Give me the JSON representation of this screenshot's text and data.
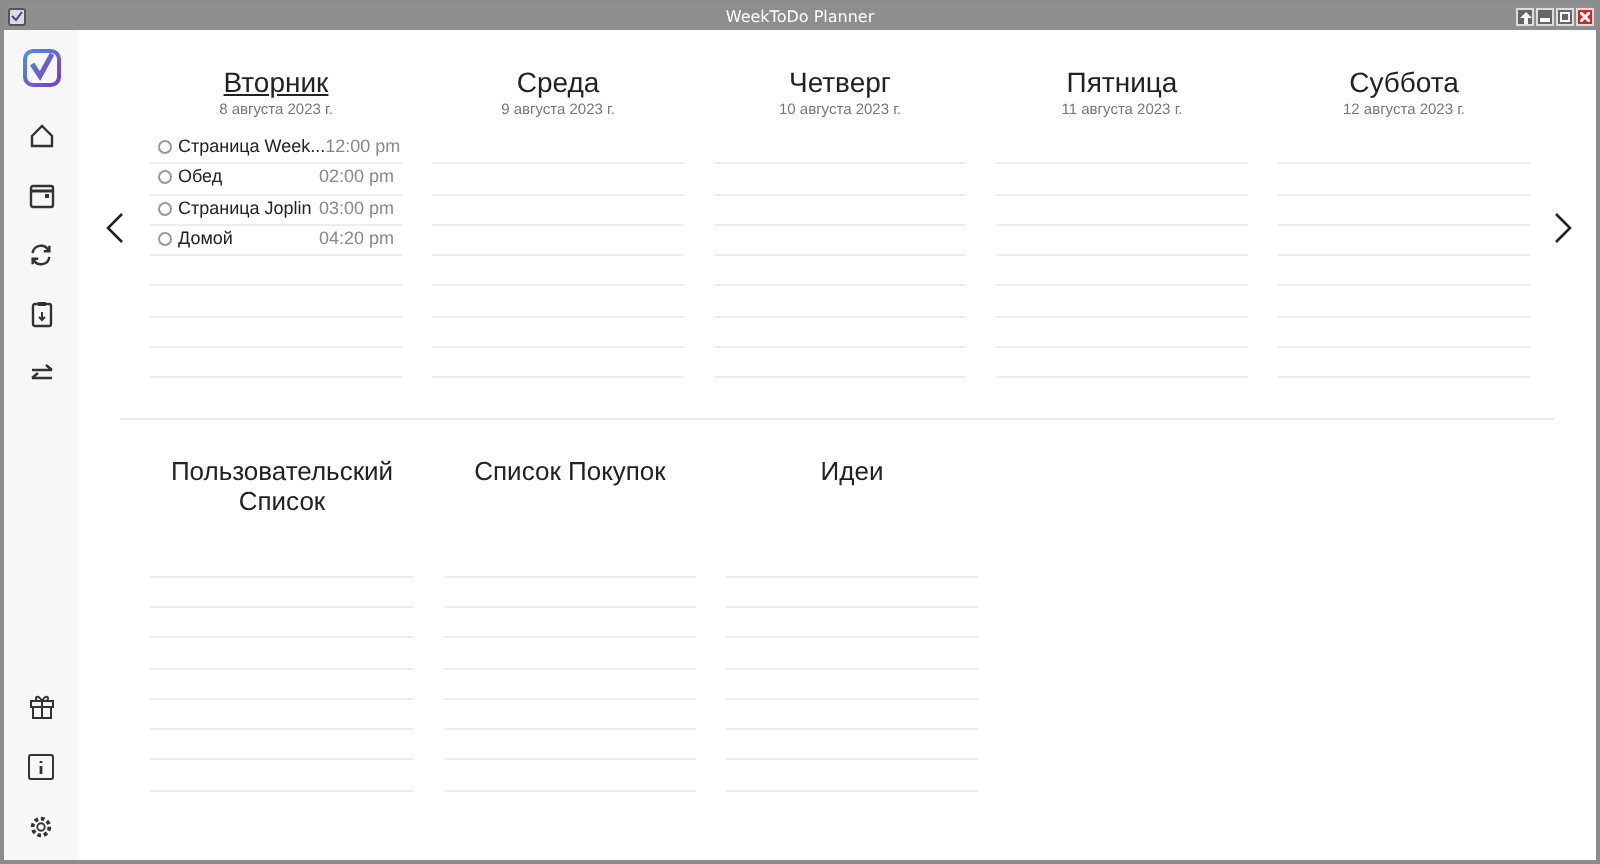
{
  "window": {
    "title": "WeekToDo Planner"
  },
  "days": [
    {
      "name": "Вторник",
      "date": "8 августа 2023 г.",
      "today": true,
      "tasks": [
        {
          "text": "Страница Week...",
          "time": "12:00 pm",
          "done": false
        },
        {
          "text": "Обед",
          "time": "02:00 pm",
          "done": false
        },
        {
          "text": "Страница Joplin",
          "time": "03:00 pm",
          "done": false
        },
        {
          "text": "Домой",
          "time": "04:20 pm",
          "done": false
        }
      ]
    },
    {
      "name": "Среда",
      "date": "9 августа 2023 г.",
      "today": false
    },
    {
      "name": "Четверг",
      "date": "10 августа 2023 г.",
      "today": false
    },
    {
      "name": "Пятница",
      "date": "11 августа 2023 г.",
      "today": false
    },
    {
      "name": "Суббота",
      "date": "12 августа 2023 г.",
      "today": false
    }
  ],
  "lists": [
    {
      "title": "Пользовательский Список"
    },
    {
      "title": "Список Покупок"
    },
    {
      "title": "Идеи"
    }
  ]
}
